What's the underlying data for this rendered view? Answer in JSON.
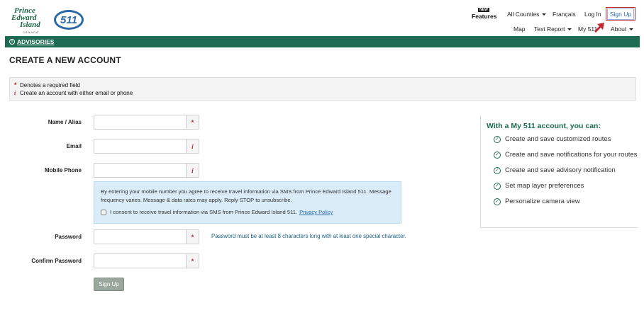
{
  "header": {
    "logo": {
      "text_line1": "Prince",
      "text_line2": "Edward",
      "text_line3": "Island",
      "subtext": "CANADA",
      "badge": "511"
    },
    "nav": {
      "features_badge": "NEW",
      "features": "Features",
      "all_counties": "All Counties",
      "francais": "Français",
      "login": "Log In",
      "signup": "Sign Up",
      "map": "Map",
      "text_report": "Text Report",
      "my511": "My 511",
      "about": "About"
    },
    "highlight_color": "#c0282d"
  },
  "advisories": {
    "label": "ADVISORIES",
    "bar_color": "#1d6b52"
  },
  "page": {
    "title": "CREATE A NEW ACCOUNT"
  },
  "notice": {
    "required_symbol": "*",
    "required_text": "Denotes a required field",
    "info_symbol": "i",
    "info_text": "Create an account with either email or phone"
  },
  "form": {
    "name": {
      "label": "Name / Alias",
      "value": "",
      "addon": "*"
    },
    "email": {
      "label": "Email",
      "value": "",
      "addon": "i"
    },
    "phone": {
      "label": "Mobile Phone",
      "value": "",
      "addon": "i"
    },
    "sms": {
      "text": "By entering your mobile number you agree to receive travel information via SMS from Prince Edward Island 511. Message frequency varies. Message & data rates may apply. Reply STOP to unsubscribe.",
      "consent": "I consent to receive travel information via SMS from Prince Edward Island 511.",
      "privacy_link": "Privacy Policy",
      "checked": false
    },
    "password": {
      "label": "Password",
      "value": "",
      "addon": "*",
      "hint": "Password must be at least 8 characters long with at least one special character."
    },
    "confirm_password": {
      "label": "Confirm Password",
      "value": "",
      "addon": "*"
    },
    "submit": "Sign Up"
  },
  "benefits": {
    "title": "With a My 511 account, you can:",
    "items": [
      "Create and save customized routes",
      "Create and save notifications for your routes",
      "Create and save advisory notification",
      "Set map layer preferences",
      "Personalize camera view"
    ],
    "icon": "check-circle-icon"
  }
}
